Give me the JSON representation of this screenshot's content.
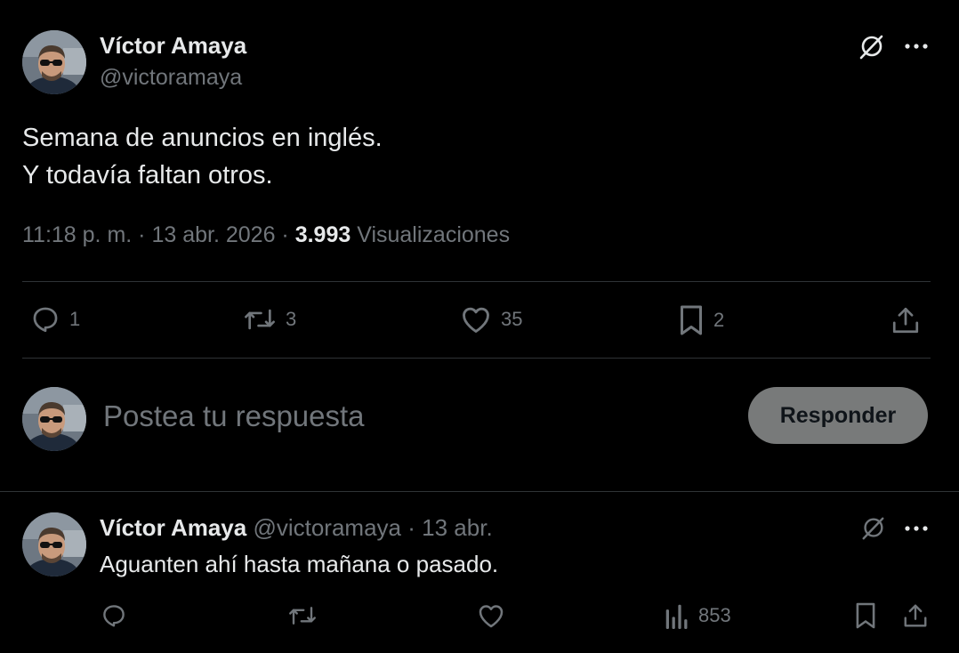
{
  "main_post": {
    "author": {
      "name": "Víctor Amaya",
      "handle": "@victoramaya"
    },
    "text_lines": [
      "Semana de anuncios en inglés.",
      "Y todavía faltan otros."
    ],
    "meta": {
      "time": "11:18 p. m.",
      "separator": "·",
      "date": "13 abr. 2026",
      "views_count": "3.993",
      "views_label": "Visualizaciones"
    },
    "actions": {
      "replies": "1",
      "reposts": "3",
      "likes": "35",
      "bookmarks": "2"
    },
    "icons": [
      "grok-icon",
      "more-icon",
      "reply-icon",
      "repost-icon",
      "like-icon",
      "bookmark-icon",
      "share-icon"
    ]
  },
  "composer": {
    "placeholder": "Postea tu respuesta",
    "submit_label": "Responder"
  },
  "reply_post": {
    "author": {
      "name": "Víctor Amaya",
      "handle": "@victoramaya",
      "separator": "·",
      "date": "13 abr."
    },
    "text": "Aguanten ahí hasta mañana o pasado.",
    "actions": {
      "views": "853"
    }
  },
  "colors": {
    "background": "#000000",
    "text_primary": "#e7e9ea",
    "text_secondary": "#71767b",
    "divider": "#2f3336",
    "button_disabled": "#787a7a"
  }
}
